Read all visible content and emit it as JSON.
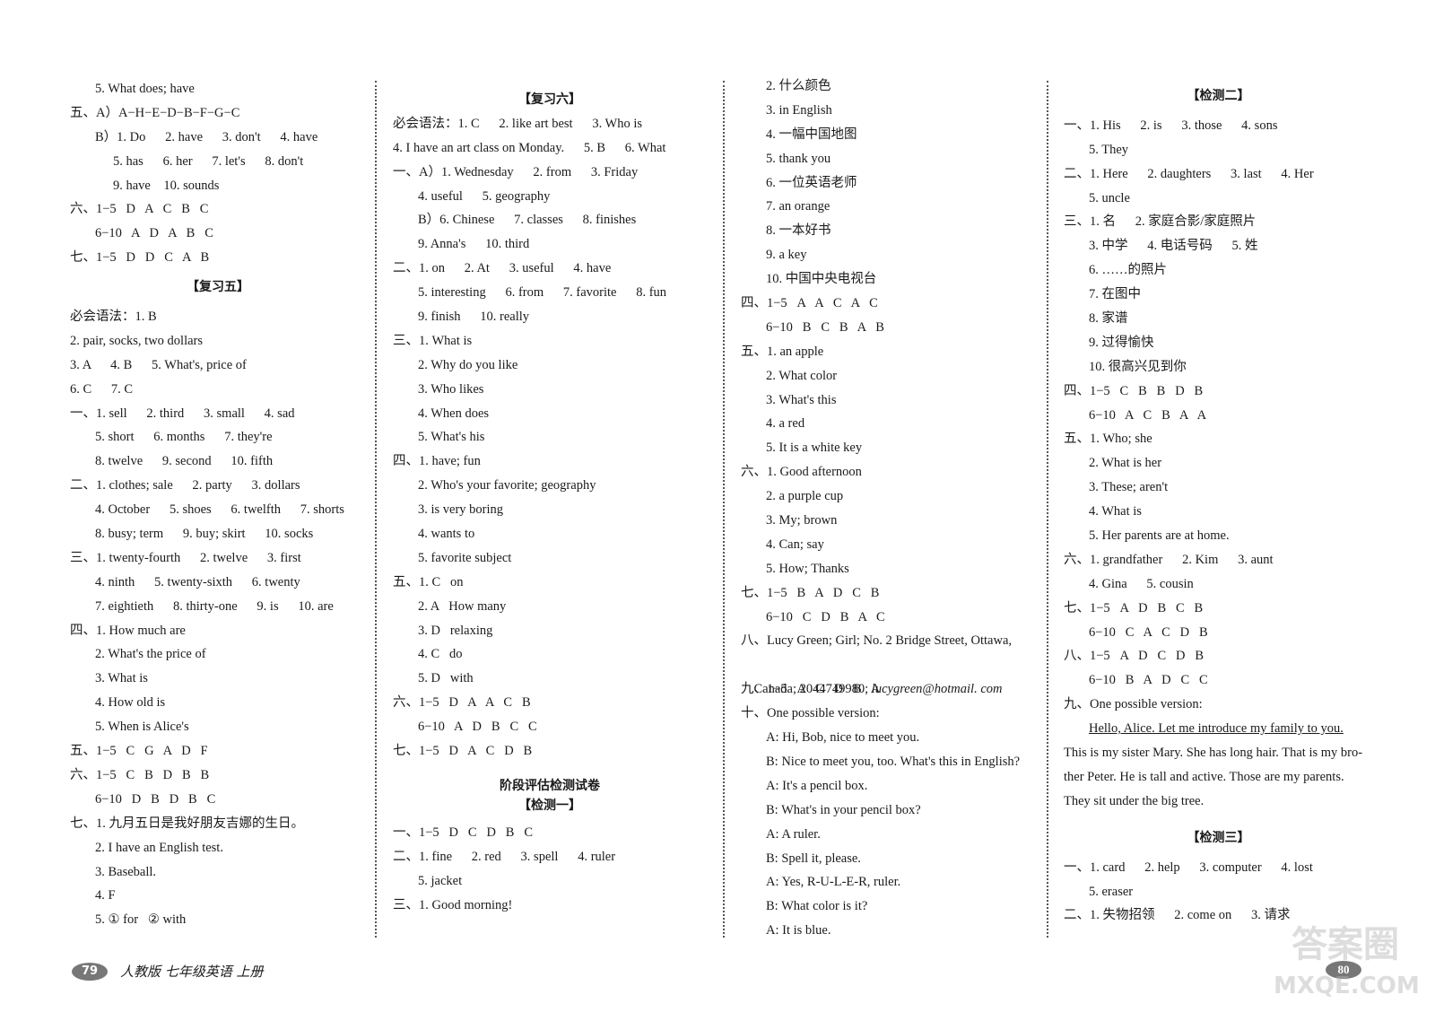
{
  "col1": {
    "l1": "5. What does; have",
    "l2": "五、A）A−H−E−D−B−F−G−C",
    "l3": "B）1. Do      2. have      3. don't      4. have",
    "l4": "5. has      6. her      7. let's      8. don't",
    "l5": "9. have    10. sounds",
    "l6": "六、1−5   D   A   C   B   C",
    "l7": "6−10   A   D   A   B   C",
    "l8": "七、1−5   D   D   C   A   B",
    "h1": "【复习五】",
    "l9": "必会语法：1. B",
    "l10": "2. pair, socks, two dollars",
    "l11": "3. A      4. B      5. What's, price of",
    "l12": "6. C      7. C",
    "l13": "一、1. sell      2. third      3. small      4. sad",
    "l14": "5. short      6. months      7. they're",
    "l15": "8. twelve      9. second      10. fifth",
    "l16": "二、1. clothes; sale      2. party      3. dollars",
    "l17": "4. October      5. shoes      6. twelfth      7. shorts",
    "l18": "8. busy; term      9. buy; skirt      10. socks",
    "l19": "三、1. twenty-fourth      2. twelve      3. first",
    "l20": "4. ninth      5. twenty-sixth      6. twenty",
    "l21": "7. eightieth      8. thirty-one      9. is      10. are",
    "l22": "四、1. How much are",
    "l23": "2. What's the price of",
    "l24": "3. What is",
    "l25": "4. How old is",
    "l26": "5. When is Alice's",
    "l27": "五、1−5   C   G   A   D   F",
    "l28": "六、1−5   C   B   D   B   B",
    "l29": "6−10   D   B   D   B   C",
    "l30": "七、1. 九月五日是我好朋友吉娜的生日。",
    "l31": "2. I have an English test.",
    "l32": "3. Baseball.",
    "l33": "4. F",
    "l34": "5. ① for   ② with"
  },
  "col2": {
    "h1": "【复习六】",
    "l1": "必会语法：1. C      2. like art best      3. Who is",
    "l2": "4. I have an art class on Monday.      5. B      6. What",
    "l3": "一、A）1. Wednesday      2. from      3. Friday",
    "l4": "4. useful      5. geography",
    "l5": "B）6. Chinese      7. classes      8. finishes",
    "l6": "9. Anna's      10. third",
    "l7": "二、1. on      2. At      3. useful      4. have",
    "l8": "5. interesting      6. from      7. favorite      8. fun",
    "l9": "9. finish      10. really",
    "l10": "三、1. What is",
    "l11": "2. Why do you like",
    "l12": "3. Who likes",
    "l13": "4. When does",
    "l14": "5. What's his",
    "l15": "四、1. have; fun",
    "l16": "2. Who's your favorite; geography",
    "l17": "3. is very boring",
    "l18": "4. wants to",
    "l19": "5. favorite subject",
    "l20": "五、1. C   on",
    "l21": "2. A   How many",
    "l22": "3. D   relaxing",
    "l23": "4. C   do",
    "l24": "5. D   with",
    "l25": "六、1−5   D   A   A   C   B",
    "l26": "6−10   A   D   B   C   C",
    "l27": "七、1−5   D   A   C   D   B",
    "h2": "阶段评估检测试卷",
    "h3": "【检测一】",
    "l28": "一、1−5   D   C   D   B   C",
    "l29": "二、1. fine      2. red      3. spell      4. ruler",
    "l30": "5. jacket",
    "l31": "三、1. Good morning!"
  },
  "col3": {
    "l1": "2. 什么颜色",
    "l2": "3. in English",
    "l3": "4. 一幅中国地图",
    "l4": "5. thank you",
    "l5": "6. 一位英语老师",
    "l6": "7. an orange",
    "l7": "8. 一本好书",
    "l8": "9. a key",
    "l9": "10. 中国中央电视台",
    "l10": "四、1−5   A   A   C   A   C",
    "l11": "6−10   B   C   B   A   B",
    "l12": "五、1. an apple",
    "l13": "2. What color",
    "l14": "3. What's this",
    "l15": "4. a red",
    "l16": "5. It is a white key",
    "l17": "六、1. Good afternoon",
    "l18": "2. a purple cup",
    "l19": "3. My; brown",
    "l20": "4. Can; say",
    "l21": "5. How; Thanks",
    "l22": "七、1−5   B   A   D   C   B",
    "l23": "6−10   C   D   B   A   C",
    "l24": "八、Lucy Green; Girl; No. 2 Bridge Street, Ottawa,",
    "l25a": "Canada; 2044749980; ",
    "l25b": "lucygreen@hotmail. com",
    "l26": "九、1−5   A   C   D   B   A",
    "l27": "十、One possible version:",
    "l28": "A: Hi, Bob, nice to meet you.",
    "l29": "B: Nice to meet you, too. What's this in English?",
    "l30": "A: It's a pencil box.",
    "l31": "B: What's in your pencil box?",
    "l32": "A: A ruler.",
    "l33": "B: Spell it, please.",
    "l34": "A: Yes, R-U-L-E-R, ruler.",
    "l35": "B: What color is it?",
    "l36": "A: It is blue."
  },
  "col4": {
    "h1": "【检测二】",
    "l1": "一、1. His      2. is      3. those      4. sons",
    "l2": "5. They",
    "l3": "二、1. Here      2. daughters      3. last      4. Her",
    "l4": "5. uncle",
    "l5": "三、1. 名      2. 家庭合影/家庭照片",
    "l6": "3. 中学      4. 电话号码      5. 姓",
    "l7": "6. ……的照片",
    "l8": "7. 在图中",
    "l9": "8. 家谱",
    "l10": "9. 过得愉快",
    "l11": "10. 很高兴见到你",
    "l12": "四、1−5   C   B   B   D   B",
    "l13": "6−10   A   C   B   A   A",
    "l14": "五、1. Who; she",
    "l15": "2. What is her",
    "l16": "3. These; aren't",
    "l17": "4. What is",
    "l18": "5. Her parents are at home.",
    "l19": "六、1. grandfather      2. Kim      3. aunt",
    "l20": "4. Gina      5. cousin",
    "l21": "七、1−5   A   D   B   C   B",
    "l22": "6−10   C   A   C   D   B",
    "l23": "八、1−5   A   D   C   D   B",
    "l24": "6−10   B   A   D   C   C",
    "l25": "九、One possible version:",
    "l26": "Hello, Alice. Let me introduce my family to you.",
    "l27": "This is my sister Mary. She has long hair. That is my bro-",
    "l28": "ther Peter. He is tall and active. Those are my parents.",
    "l29": "They sit under the big tree.",
    "h2": "【检测三】",
    "l30": "一、1. card      2. help      3. computer      4. lost",
    "l31": "5. eraser",
    "l32": "二、1. 失物招领      2. come on      3. 请求"
  },
  "footer": {
    "page_left": "79",
    "book_title": "人教版  七年级英语  上册",
    "page_right": "80"
  },
  "watermark": {
    "line1": "答案圈",
    "line2": "MXQE.COM"
  }
}
